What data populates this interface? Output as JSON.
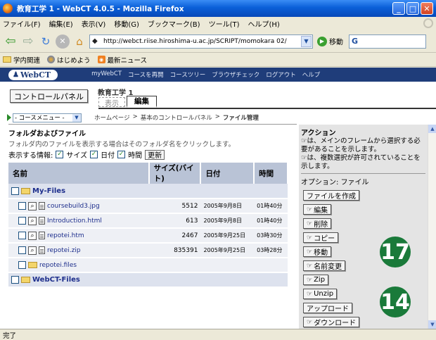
{
  "window": {
    "title": "教育工学 1 - WebCT 4.0.5 - Mozilla Firefox"
  },
  "menubar": [
    "ファイル(F)",
    "編集(E)",
    "表示(V)",
    "移動(G)",
    "ブックマーク(B)",
    "ツール(T)",
    "ヘルプ(H)"
  ],
  "navbar": {
    "url": "http://webct.riise.hiroshima-u.ac.jp/SCRIPT/momokara 02/",
    "go_label": "移動",
    "search_glyph": "G"
  },
  "bookmarks": [
    "学内関連",
    "はじめよう",
    "最新ニュース"
  ],
  "webct": {
    "logo": "WebCT",
    "topnav": [
      "myWebCT",
      "コースを再開",
      "コースツリー",
      "ブラウザチェック",
      "ログアウト",
      "ヘルプ"
    ]
  },
  "control": {
    "panel_button": "コントロールパネル",
    "course_title": "教育工学 1",
    "tab_view": "表示",
    "tab_edit": "編集"
  },
  "crumbbar": {
    "course_menu": "- コースメニュー -",
    "crumbs": [
      "ホームページ",
      "基本のコントロールパネル",
      "ファイル管理"
    ]
  },
  "files": {
    "title": "フォルダおよびファイル",
    "desc": "フォルダ内のファイルを表示する場合はそのフォルダ名をクリックします。",
    "display_label": "表示する情報:",
    "opt_size": "サイズ",
    "opt_date": "日付",
    "opt_time": "時間",
    "refresh": "更新",
    "headers": {
      "name": "名前",
      "size": "サイズ(バイト)",
      "date": "日付",
      "time": "時間"
    },
    "rows": [
      {
        "name": "My-Files",
        "size": "",
        "date": "",
        "time": ""
      },
      {
        "name": "coursebuild3.jpg",
        "size": "5512",
        "date": "2005年9月8日",
        "time": "01時40分"
      },
      {
        "name": "Introduction.html",
        "size": "613",
        "date": "2005年9月8日",
        "time": "01時40分"
      },
      {
        "name": "repotei.htm",
        "size": "2467",
        "date": "2005年9月25日",
        "time": "03時30分"
      },
      {
        "name": "repotei.zip",
        "size": "835391",
        "date": "2005年9月25日",
        "time": "03時28分"
      },
      {
        "name": "repotei.files",
        "size": "",
        "date": "",
        "time": ""
      },
      {
        "name": "WebCT-Files",
        "size": "",
        "date": "",
        "time": ""
      }
    ]
  },
  "actions": {
    "title": "アクション",
    "desc1": "は、メインのフレームから選択する必要があることを示します。",
    "desc2": "は、複数選択が許可されていることを示します。",
    "option_title": "オプション: ファイル",
    "buttons": [
      "ファイルを作成",
      "編集",
      "削除",
      "コピー",
      "移動",
      "名前変更",
      "Zip",
      "Unzip",
      "アップロード",
      "ダウンロード"
    ]
  },
  "badges": {
    "b17": "17",
    "b14": "14"
  },
  "status": "完了"
}
